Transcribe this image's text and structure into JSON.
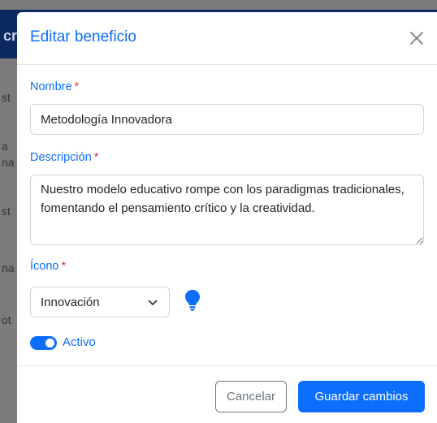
{
  "background": {
    "header_fragment": "cr",
    "side_fragments": [
      "st",
      "a",
      "na",
      "st",
      "na",
      "ot"
    ]
  },
  "modal": {
    "title": "Editar beneficio",
    "close_icon": "close-icon"
  },
  "form": {
    "required_mark": "*",
    "nombre": {
      "label": "Nombre",
      "value": "Metodología Innovadora"
    },
    "descripcion": {
      "label": "Descripción",
      "value": "Nuestro modelo educativo rompe con los paradigmas tradicionales, fomentando el pensamiento crítico y la creatividad."
    },
    "icono": {
      "label": "Ícono",
      "selected": "Innovación",
      "preview_icon": "lightbulb-icon"
    },
    "activo": {
      "label": "Activo",
      "checked": true
    }
  },
  "footer": {
    "cancel_label": "Cancelar",
    "save_label": "Guardar cambios"
  },
  "colors": {
    "accent": "#0d6efd",
    "required": "#dc3545",
    "backdrop": "#7b7b7b",
    "header_bg": "#0c2a60"
  }
}
